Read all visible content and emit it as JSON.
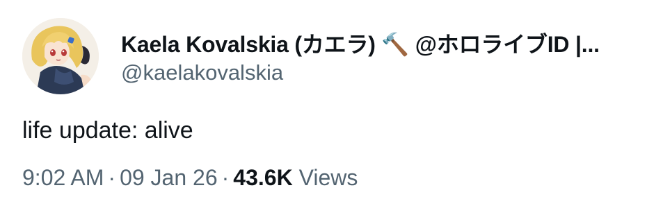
{
  "tweet": {
    "display_name": "Kaela Kovalskia (カエラ) 🔨 @ホロライブID |...",
    "handle": "@kaelakovalskia",
    "text": "life update: alive",
    "time": "9:02 AM",
    "separator": "·",
    "date": "09 Jan 26",
    "views_count": "43.6K",
    "views_label": "Views"
  },
  "colors": {
    "text_primary": "#0f1419",
    "text_secondary": "#536471",
    "background": "#ffffff"
  },
  "icons": {
    "avatar": "user-avatar-illustration"
  }
}
